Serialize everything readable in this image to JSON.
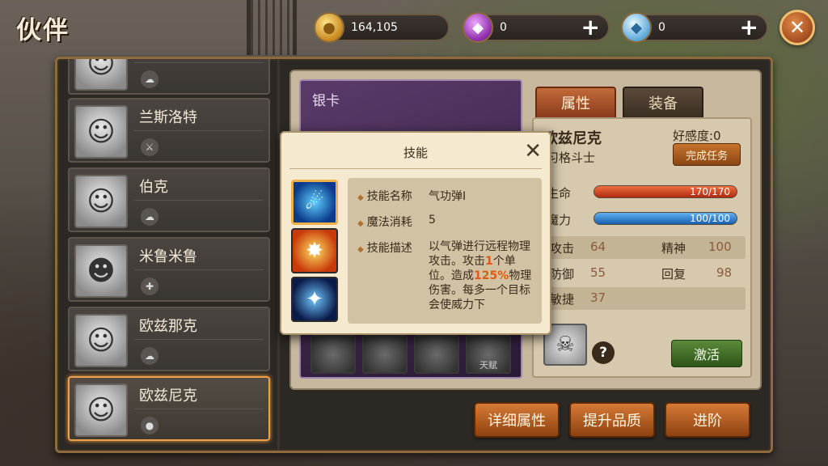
{
  "header": {
    "title": "伙伴",
    "gold": "164,105",
    "purple_gems": "0",
    "blue_gems": "0",
    "plus_symbol": "+",
    "close_symbol": "✕"
  },
  "partners": [
    {
      "name": "",
      "type_icon": "wind-icon"
    },
    {
      "name": "兰斯洛特",
      "type_icon": "attack-icon"
    },
    {
      "name": "伯克",
      "type_icon": "wind-icon"
    },
    {
      "name": "米鲁米鲁",
      "type_icon": "support-icon"
    },
    {
      "name": "欧兹那克",
      "type_icon": "wind-icon"
    },
    {
      "name": "欧兹尼克",
      "type_icon": "orb-icon",
      "selected": true
    }
  ],
  "card": {
    "rarity": "银卡",
    "talent_label": "天赋"
  },
  "tabs": {
    "attributes": "属性",
    "equipment": "装备"
  },
  "hero": {
    "name": "欧兹尼克",
    "class": "习格斗士",
    "affinity": "好感度:0",
    "task_button": "完成任务",
    "hp_label": "生命",
    "hp_value": "170/170",
    "hp_fraction": 1.0,
    "mp_label": "魔力",
    "mp_value": "100/100",
    "mp_fraction": 1.0,
    "stats": {
      "attack_label": "攻击",
      "attack": "64",
      "spirit_label": "精神",
      "spirit": "100",
      "defense_label": "防御",
      "defense": "55",
      "recovery_label": "回复",
      "recovery": "98",
      "agility_label": "敏捷",
      "agility": "37"
    },
    "activate_button": "激活",
    "help_symbol": "?"
  },
  "bottom_buttons": {
    "details": "详细属性",
    "upgrade_quality": "提升品质",
    "advance": "进阶"
  },
  "popup": {
    "title": "技能",
    "close_symbol": "✕",
    "name_label": "技能名称",
    "name_value": "气功弹Ⅰ",
    "cost_label": "魔法消耗",
    "cost_value": "5",
    "desc_label": "技能描述",
    "desc_part1": "以气弹进行远程物理攻击。攻击",
    "desc_hl1": "1",
    "desc_part2": "个单位。造成",
    "desc_hl2": "125%",
    "desc_part3": "物理伤害。每多一个目标会使威力下"
  },
  "colors": {
    "accent_orange": "#d67a36",
    "highlight": "#e05a10",
    "hp_bar": "#e04a20",
    "mp_bar": "#3a8ad8",
    "selected_border": "#f0a048"
  }
}
